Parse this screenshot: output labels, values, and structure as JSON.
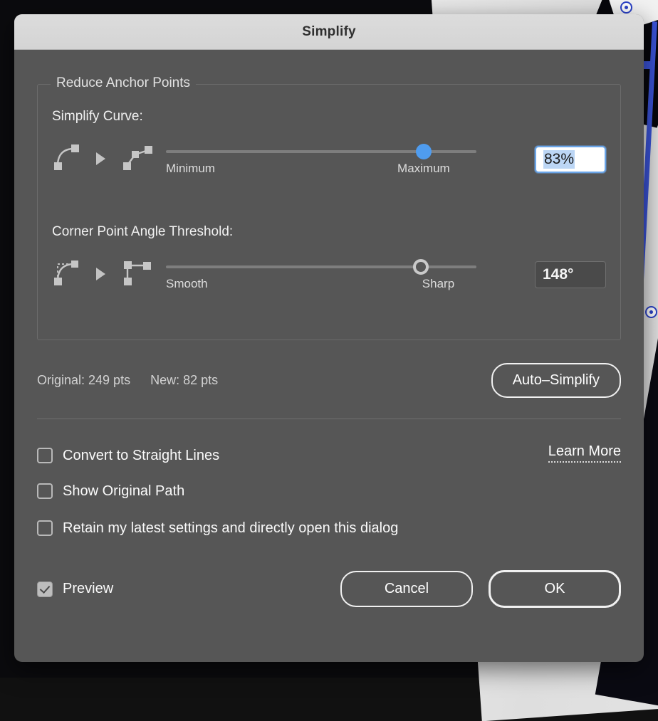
{
  "window": {
    "title": "Simplify"
  },
  "group": {
    "legend": "Reduce Anchor Points"
  },
  "simplify_curve": {
    "label": "Simplify Curve:",
    "icon_from": "curve-smooth-icon",
    "icon_arrow": "arrow-right-icon",
    "icon_to": "curve-segmented-icon",
    "min_label": "Minimum",
    "max_label": "Maximum",
    "value": "83%",
    "value_number": 83,
    "focused": true,
    "knob_style": "filled",
    "knob_color": "#4f9cef"
  },
  "corner_threshold": {
    "label": "Corner Point Angle Threshold:",
    "icon_from": "corner-smooth-icon",
    "icon_arrow": "arrow-right-icon",
    "icon_to": "corner-sharp-icon",
    "min_label": "Smooth",
    "max_label": "Sharp",
    "value": "148°",
    "value_number": 148,
    "focused": false,
    "knob_style": "ring"
  },
  "stats": {
    "original": "Original: 249 pts",
    "new": "New: 82 pts",
    "auto_simplify_label": "Auto–Simplify"
  },
  "options": [
    {
      "label": "Convert to Straight Lines",
      "checked": false,
      "name": "convert-to-straight-lines"
    },
    {
      "label": "Show Original Path",
      "checked": false,
      "name": "show-original-path"
    },
    {
      "label": "Retain my latest settings and directly open this dialog",
      "checked": false,
      "name": "retain-settings"
    }
  ],
  "learn_more": {
    "label": "Learn More"
  },
  "footer": {
    "preview_label": "Preview",
    "preview_checked": true,
    "cancel_label": "Cancel",
    "ok_label": "OK"
  },
  "colors": {
    "dialog_bg": "#565656",
    "titlebar_bg": "#d8d8d8",
    "accent": "#4f9cef",
    "selection": "#bcd6f5",
    "text": "#fafafa"
  }
}
